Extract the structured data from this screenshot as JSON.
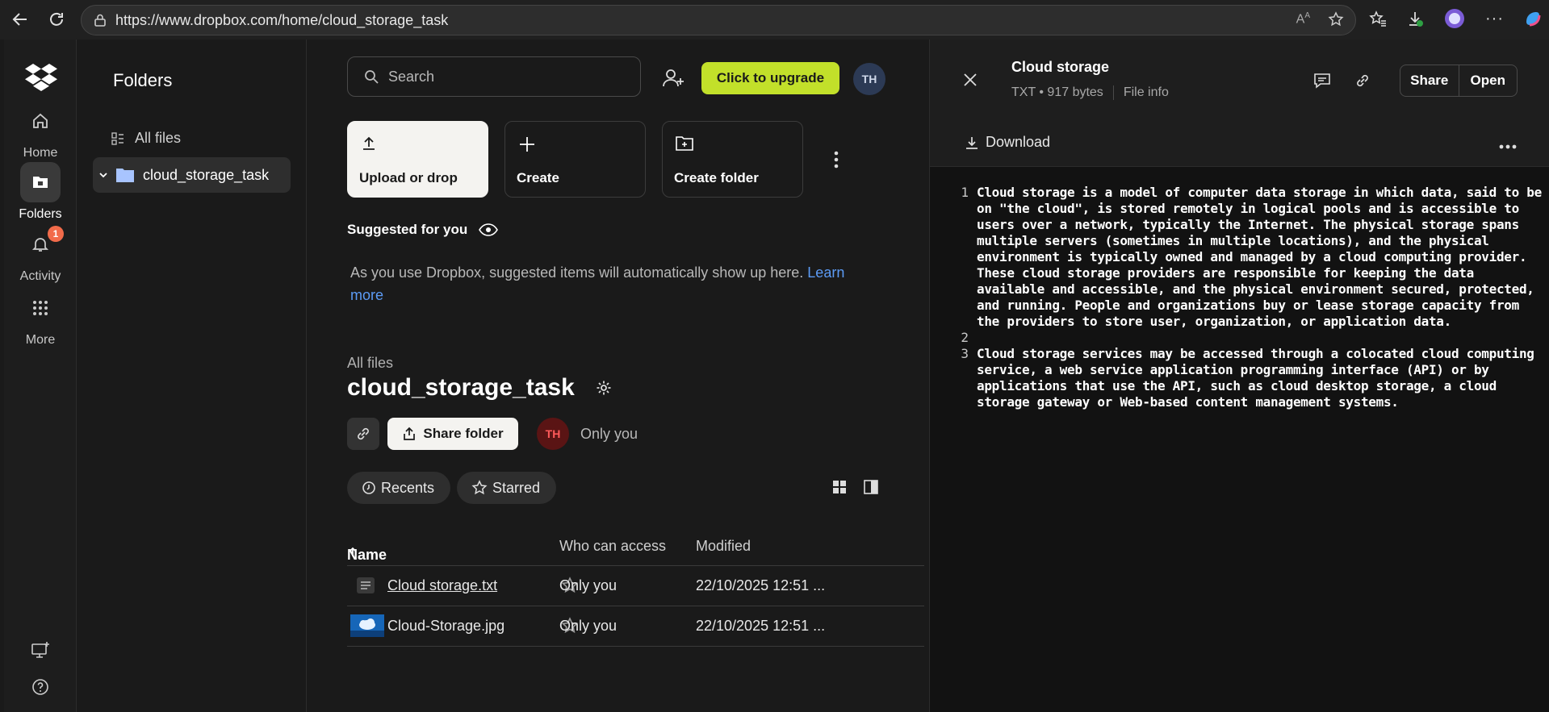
{
  "browser": {
    "url": "https://www.dropbox.com/home/cloud_storage_task"
  },
  "rail": {
    "items": [
      {
        "label": "Home"
      },
      {
        "label": "Folders"
      },
      {
        "label": "Activity",
        "badge": "1"
      },
      {
        "label": "More"
      }
    ]
  },
  "folders_panel": {
    "title": "Folders",
    "all_files": "All files",
    "current_folder": "cloud_storage_task"
  },
  "topbar": {
    "search_placeholder": "Search",
    "upgrade_label": "Click to upgrade",
    "avatar_initials": "TH"
  },
  "actions": {
    "upload": "Upload or drop",
    "create": "Create",
    "create_folder": "Create folder"
  },
  "suggested": {
    "title": "Suggested for you",
    "text": "As you use Dropbox, suggested items will automatically show up here.",
    "learn_more": "Learn more"
  },
  "folder": {
    "breadcrumb": "All files",
    "title": "cloud_storage_task",
    "share_label": "Share folder",
    "owner_initials": "TH",
    "access": "Only you"
  },
  "filters": {
    "recents": "Recents",
    "starred": "Starred"
  },
  "table": {
    "headers": {
      "name": "Name",
      "access": "Who can access",
      "modified": "Modified"
    },
    "rows": [
      {
        "name": "Cloud storage.txt",
        "access": "Only you",
        "modified": "22/10/2025 12:51 ..."
      },
      {
        "name": "Cloud-Storage.jpg",
        "access": "Only you",
        "modified": "22/10/2025 12:51 ..."
      }
    ]
  },
  "preview": {
    "title": "Cloud storage",
    "meta": "TXT • 917 bytes",
    "file_info": "File info",
    "share": "Share",
    "open": "Open",
    "download": "Download",
    "lines": [
      {
        "n": "1",
        "text": "Cloud storage is a model of computer data storage in which data, said to be on \"the cloud\", is stored remotely in logical pools and is accessible to users over a network, typically the Internet. The physical storage spans multiple servers (sometimes in multiple locations), and the physical environment is typically owned and managed by a cloud computing provider. These cloud storage providers are responsible for keeping the data available and accessible, and the physical environment secured, protected, and running. People and organizations buy or lease storage capacity from the providers to store user, organization, or application data."
      },
      {
        "n": "2",
        "text": ""
      },
      {
        "n": "3",
        "text": "Cloud storage services may be accessed through a colocated cloud computing service, a web service application programming interface (API) or by applications that use the API, such as cloud desktop storage, a cloud storage gateway or Web-based content management systems."
      }
    ]
  }
}
